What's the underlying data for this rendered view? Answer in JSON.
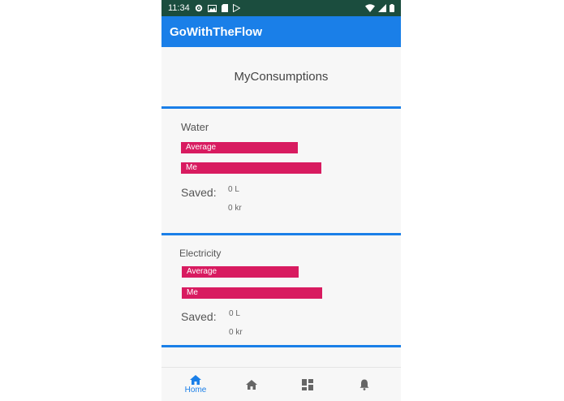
{
  "status_bar": {
    "time": "11:34"
  },
  "app": {
    "title": "GoWithTheFlow"
  },
  "page": {
    "title": "MyConsumptions"
  },
  "cards": [
    {
      "title": "Water",
      "average_label": "Average",
      "average_level": 0.83,
      "me_label": "Me",
      "me_level": 1.0,
      "saved_label": "Saved:",
      "saved_amount": "0 L",
      "saved_money": "0 kr"
    },
    {
      "title": "Electricity",
      "average_label": "Average",
      "average_level": 0.83,
      "me_label": "Me",
      "me_level": 1.0,
      "saved_label": "Saved:",
      "saved_amount": "0 L",
      "saved_money": "0 kr"
    }
  ],
  "bottom_nav": {
    "items": [
      {
        "icon": "home-icon",
        "label": "Home",
        "active": true
      },
      {
        "icon": "home-icon",
        "label": "",
        "active": false
      },
      {
        "icon": "dashboard-icon",
        "label": "",
        "active": false
      },
      {
        "icon": "bell-icon",
        "label": "",
        "active": false
      }
    ]
  },
  "colors": {
    "primary": "#1a7fe8",
    "bar": "#d81b60",
    "status_bar": "#1b4d3e"
  }
}
